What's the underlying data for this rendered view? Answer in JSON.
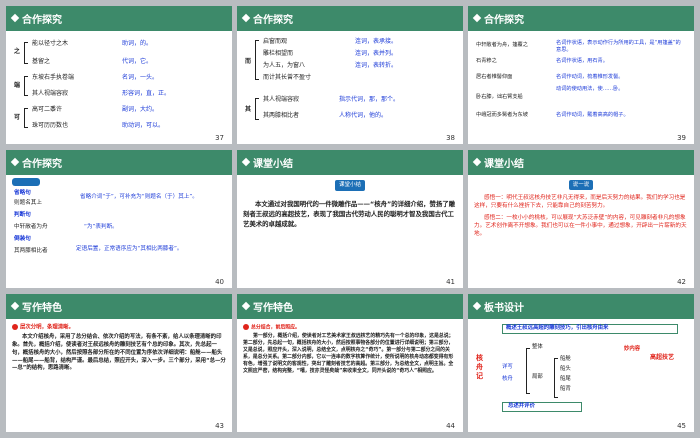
{
  "slides": [
    {
      "title": "合作探究",
      "num": "37",
      "lines": [
        {
          "k": "之",
          "a": "能以径寸之木",
          "b": "助词，的。"
        },
        {
          "k": "",
          "a": "基留之",
          "b": "代词，它。"
        },
        {
          "k": "端",
          "a": "东坡右手执卷端",
          "b": "名词，一头。"
        },
        {
          "k": "",
          "a": "其人视端容寂",
          "b": "形容词，直，正。"
        },
        {
          "k": "可",
          "a": "高可二黍许",
          "b": "副词，大约。"
        },
        {
          "k": "",
          "a": "珠可历历数也",
          "b": "助动词，可以。"
        }
      ]
    },
    {
      "title": "合作探究",
      "num": "38",
      "lines": [
        {
          "k": "而",
          "a": "启窗而观",
          "b": "连词，表承接。"
        },
        {
          "k": "",
          "a": "雕栏相望而",
          "b": "连词，表并列。"
        },
        {
          "k": "",
          "a": "为人五，为窗八",
          "b": "连词，表转折。"
        },
        {
          "k": "",
          "a": "而计其长曾不盈寸",
          "b": ""
        },
        {
          "k": "其",
          "a": "其人视端容寂",
          "b": "指示代词，那，那个。"
        },
        {
          "k": "",
          "a": "其两膝相比者",
          "b": "人称代词，他的。"
        }
      ]
    },
    {
      "title": "合作探究",
      "num": "39",
      "lines": [
        {
          "a": "中轩敞者为舟，篷覆之",
          "b": "名词作状语，表示动作行为所用的工具，是“用篷盖”的意思。"
        },
        {
          "a": "石青糁之",
          "b": "名词作状语，用石青。"
        },
        {
          "a": "居右者椎髻仰面",
          "b": "名词作动词，梳着椎形发髻。"
        },
        {
          "a": "",
          "b": "动词的使动用法，使……卧。"
        },
        {
          "a": "卧右膝，诎右臂支船",
          "b": ""
        },
        {
          "a": "中峨冠而多髯者为东坡",
          "b": "名词作动词，戴着高高的帽子。"
        }
      ]
    },
    {
      "title": "合作探究",
      "num": "40",
      "lines": [
        {
          "a": "省略句",
          "b": ""
        },
        {
          "a": "则题名其上",
          "b": "省略介词“于”，可补充为“则题名（于）其上”。"
        },
        {
          "a": "判断句",
          "b": ""
        },
        {
          "a": "中轩敞者为舟",
          "b": "“为”表判断。"
        },
        {
          "a": "倒装句",
          "b": ""
        },
        {
          "a": "其两膝相比者",
          "b": "定语后置，正常语序应为“其相比两膝者”。"
        }
      ]
    },
    {
      "title": "课堂小结",
      "num": "41",
      "badge": "课堂小结",
      "text": "本文通过对我国明代的一件微雕作品——“核舟”的详细介绍，赞扬了雕刻者王叔远的高超技艺，表现了我国古代劳动人民的聪明才智及我国古代工艺美术的卓越成就。"
    },
    {
      "title": "课堂小结",
      "num": "42",
      "badge": "说一说",
      "p1": "感悟一：明代王叔远核舟技艺非凡无得来，而是后天努力的结果。我们的学习也是这样，只要有什么挫折下去，只能靠自己的刻苦努力。",
      "p2": "感悟二：一枚小小的桃核，可以展现“大苏泛赤壁”的内容，可见雕刻者非凡的想象力。艺术创作离不开想象。我们也可以在一件小事中，通过想象，开辟出一片崭新的天地。"
    },
    {
      "title": "写作特色",
      "num": "43",
      "sub": "层次分明，条理清晰。",
      "text": "本文介绍核舟，采用了总分结合、依次介绍的写法，有条不紊，给人以条理清晰的印象。首先，概括介绍，使读者对王叔远核舟的雕刻技艺有个总的印象。其次，先总起一句，概括核舟的大小，然后按照各部分所在的不同位置为序依次详细说明：船舱——船头——船尾——船背，结构严谨。最后总结，照应开头，深入一步。三个部分，采用“总—分—总”的结构，思路清晰。"
    },
    {
      "title": "写作特色",
      "num": "44",
      "sub": "总分结合，前后照应。",
      "text": "第一部分，概括介绍，使读者对工艺美术家王叔远核艺的精巧先有一个总的印象，这是总说；第二部分，先总起一句，概括核舟的大小，然后按照事物各部分的位置进行详细说明；第三部分，又是总说，照应开头，深入说明，总结全文，点明核舟之“奇巧”。第一部分与第二部分之间的关系，是总分关系。第二部分内部，它以一连串的数字核算作统计，使所说明的核舟动态都变得有形有色，增强了说明文的客观性，突出了雕刻者技艺的高超。第三部分，为总结全文，点明主旨。全文照应严密，结构完整，“嘻，技亦灵怪矣哉”来收束全文，同开头说的“奇巧人”相照应。"
    },
    {
      "title": "板书设计",
      "num": "45",
      "top": "概述王叔远高超的雕刻技巧，引出核舟由来",
      "left": "核舟记",
      "mid1": "详写",
      "mid2": "核舟",
      "right_a": "整体",
      "right_b": "局部",
      "parts": [
        "船舱",
        "船头",
        "船尾",
        "船背"
      ],
      "far": "妙内容",
      "side": "高超技艺",
      "bottom": "总述并评价"
    }
  ]
}
